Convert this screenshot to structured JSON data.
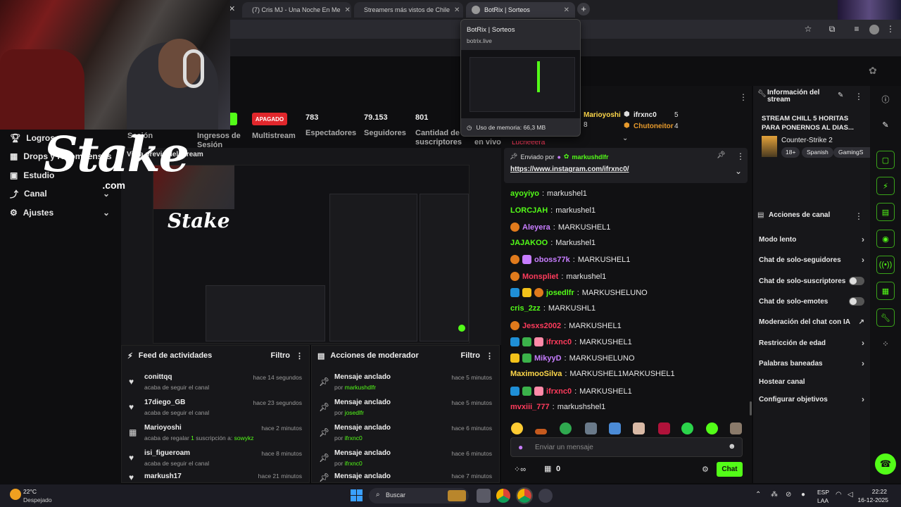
{
  "browser": {
    "tabs": [
      {
        "label": "(7) Cris MJ - Una Noche En Me"
      },
      {
        "label": "Streamers más vistos de Chile"
      },
      {
        "label": "BotRix | Sorteos"
      }
    ],
    "new_tab": "+",
    "tooltip": {
      "title": "BotRix | Sorteos",
      "domain": "botrix.live",
      "memory": "Uso de memoria: 66,3 MB"
    }
  },
  "overlay": {
    "logo_word": "Stake",
    "logo_com": ".com"
  },
  "sidebar": {
    "items": [
      {
        "label": "Logros",
        "icon": "trophy-icon"
      },
      {
        "label": "Drops y recompensas",
        "icon": "gift-icon"
      },
      {
        "label": "Estudio",
        "icon": "studio-icon"
      },
      {
        "label": "Canal",
        "icon": "channel-icon"
      },
      {
        "label": "Ajustes",
        "icon": "gear-icon"
      }
    ]
  },
  "stats": {
    "session_label": "Sesión",
    "ingresos_label": "Ingresos de Sesión",
    "status": "APAGADO",
    "multistream": "Multistream",
    "viewers": "783",
    "viewers_label": "Espectadores",
    "followers": "79.153",
    "followers_label": "Seguidores",
    "subs": "801",
    "subs_label": "Cantidad de suscriptores",
    "live_label": "en vivo"
  },
  "preview": {
    "title": "Vista previa del stream"
  },
  "feed": {
    "title": "Feed de actividades",
    "filter": "Filtro",
    "rows": [
      {
        "icon": "heart-icon",
        "user": "conittqq",
        "text": "acaba de seguir el canal",
        "time": "hace 14 segundos"
      },
      {
        "icon": "heart-icon",
        "user": "17diego_GB",
        "text": "acaba de seguir el canal",
        "time": "hace 23 segundos"
      },
      {
        "icon": "gift-icon",
        "user": "Marioyoshi",
        "text_a": "acaba de regalar ",
        "count": "1",
        "text_b": " suscripción a: ",
        "target": "sowykz",
        "time": "hace 2 minutos"
      },
      {
        "icon": "heart-icon",
        "user": "isi_figueroam",
        "text": "acaba de seguir el canal",
        "time": "hace 8 minutos"
      },
      {
        "icon": "heart-icon",
        "user": "markush17",
        "text": "",
        "time": "hace 21 minutos"
      }
    ]
  },
  "mod": {
    "title": "Acciones de moderador",
    "filter": "Filtro",
    "rows": [
      {
        "action": "Mensaje anclado",
        "by": "por ",
        "user": "markushdlfr",
        "time": "hace 5 minutos"
      },
      {
        "action": "Mensaje anclado",
        "by": "por ",
        "user": "josedlfr",
        "time": "hace 5 minutos"
      },
      {
        "action": "Mensaje anclado",
        "by": "por ",
        "user": "ifrxnc0",
        "time": "hace 6 minutos"
      },
      {
        "action": "Mensaje anclado",
        "by": "por ",
        "user": "ifrxnc0",
        "time": "hace 6 minutos"
      },
      {
        "action": "Mensaje anclado",
        "by": "",
        "user": "",
        "time": "hace 7 minutos"
      }
    ]
  },
  "chat": {
    "top_gifters": [
      {
        "name": "Marioyoshi",
        "count": "8"
      },
      {
        "name": "ifrxnc0",
        "count": "5"
      },
      {
        "name": "Chutoneitor",
        "count": "4"
      }
    ],
    "cut_name": "Lucheeera",
    "pinned": {
      "label": "Enviado por",
      "user": "markushdlfr",
      "link": "https://www.instagram.com/ifrxnc0/"
    },
    "messages": [
      {
        "user": "ayoyiyo",
        "color": "#53fc18",
        "text": "markushel1"
      },
      {
        "user": "LORCJAH",
        "color": "#53fc18",
        "text": "markushel1"
      },
      {
        "user": "Aleyera",
        "color": "#c77dff",
        "text": "MARKUSHEL1"
      },
      {
        "user": "JAJAKOO",
        "color": "#53fc18",
        "text": "Markushel1"
      },
      {
        "user": "oboss77k",
        "color": "#c77dff",
        "text": "MARKUSHEL1"
      },
      {
        "user": "Monspliet",
        "color": "#ff3b5c",
        "text": "markushel1"
      },
      {
        "user": "josedlfr",
        "color": "#53fc18",
        "text": "MARKUSHELUNO"
      },
      {
        "user": "cris_2zz",
        "color": "#53fc18",
        "text": "MARKUSHL1"
      },
      {
        "user": "Jesxs2002",
        "color": "#ff3b5c",
        "text": "MARKUSHEL1"
      },
      {
        "user": "ifrxnc0",
        "color": "#ff3b5c",
        "text": "MARKUSHEL1"
      },
      {
        "user": "MikyyD",
        "color": "#c77dff",
        "text": "MARKUSHELUNO"
      },
      {
        "user": "MaximooSilva",
        "color": "#ffd84a",
        "text": "MARKUSHEL1MARKUSHEL1"
      },
      {
        "user": "ifrxnc0",
        "color": "#ff3b5c",
        "text": "MARKUSHEL1"
      },
      {
        "user": "mvxiii_777",
        "color": "#ff3b5c",
        "text": "markushshel1"
      }
    ],
    "input_placeholder": "Enviar un mensaje",
    "points": "0",
    "send": "Chat"
  },
  "info": {
    "title": "Información del stream",
    "stream_title": "STREAM CHILL 5 HORITAS PARA PONERNOS AL DIAS...",
    "category": "Counter-Strike 2",
    "tags": [
      "18+",
      "Spanish",
      "GamingS"
    ]
  },
  "acciones": {
    "title": "Acciones de canal",
    "rows": [
      {
        "label": "Modo lento",
        "type": "chevron"
      },
      {
        "label": "Chat de solo-seguidores",
        "type": "chevron"
      },
      {
        "label": "Chat de solo-suscriptores",
        "type": "toggle"
      },
      {
        "label": "Chat de solo-emotes",
        "type": "toggle"
      },
      {
        "label": "Moderación del chat con IA",
        "type": "external"
      },
      {
        "label": "Restricción de edad",
        "type": "chevron"
      },
      {
        "label": "Palabras baneadas",
        "type": "chevron"
      },
      {
        "label": "Hostear canal",
        "type": "none"
      },
      {
        "label": "Configurar objetivos",
        "type": "chevron"
      }
    ]
  },
  "taskbar": {
    "weather_temp": "22°C",
    "weather_desc": "Despejado",
    "search": "Buscar",
    "lang": "ESP",
    "lang2": "LAA",
    "time": "22:22",
    "date": "16-12-2025"
  },
  "colors": {
    "kick_green": "#53fc18",
    "offline_red": "#e1272c"
  }
}
